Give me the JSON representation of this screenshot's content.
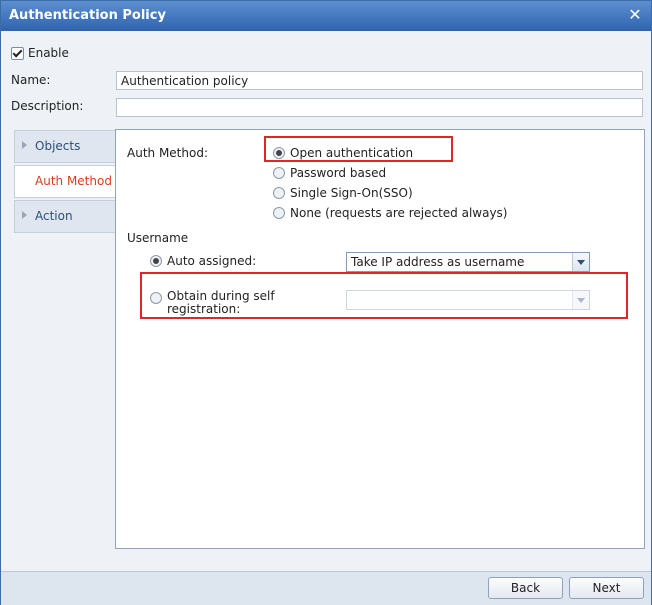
{
  "window": {
    "title": "Authentication Policy",
    "close_glyph": "✕"
  },
  "enable": {
    "label": "Enable",
    "checked": true
  },
  "name": {
    "label": "Name:",
    "value": "Authentication policy"
  },
  "description": {
    "label": "Description:",
    "value": ""
  },
  "nav": {
    "items": [
      {
        "label": "Objects",
        "active": false
      },
      {
        "label": "Auth Method",
        "active": true
      },
      {
        "label": "Action",
        "active": false
      }
    ]
  },
  "auth_method": {
    "label": "Auth Method:",
    "options": [
      {
        "label": "Open authentication",
        "selected": true
      },
      {
        "label": "Password based",
        "selected": false
      },
      {
        "label": "Single Sign-On(SSO)",
        "selected": false
      },
      {
        "label": "None (requests are rejected always)",
        "selected": false
      }
    ]
  },
  "username": {
    "label": "Username",
    "auto_assigned": {
      "label": "Auto assigned:",
      "selected": true,
      "dropdown_value": "Take IP address as username"
    },
    "self_registration": {
      "label": "Obtain during self registration:",
      "selected": false,
      "dropdown_value": ""
    }
  },
  "footer": {
    "back_label": "Back",
    "next_label": "Next"
  },
  "colors": {
    "title_bar": "#2f64ad",
    "active_nav_text": "#d63e1e",
    "highlight": "#e0252b"
  }
}
